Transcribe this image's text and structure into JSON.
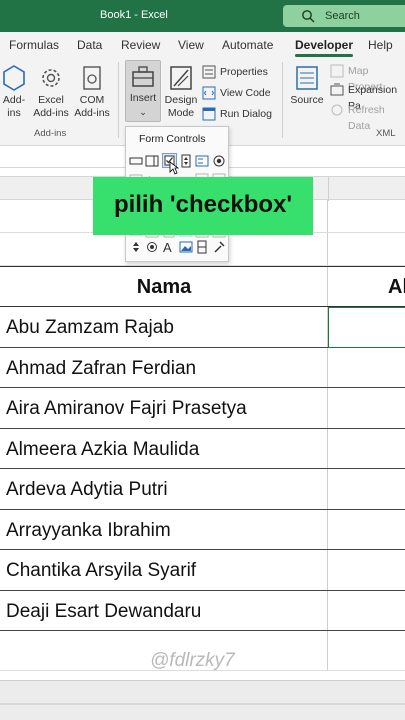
{
  "titlebar": {
    "title": "Book1  -  Excel",
    "search_label": "Search",
    "search_icon": "search-icon",
    "color": "#217346"
  },
  "tabs": [
    {
      "label": "Formulas"
    },
    {
      "label": "Data"
    },
    {
      "label": "Review"
    },
    {
      "label": "View"
    },
    {
      "label": "Automate"
    },
    {
      "label": "Developer",
      "active": true
    },
    {
      "label": "Help"
    }
  ],
  "ribbon": {
    "addins": {
      "add_ins": "Add-\nins",
      "excel_add_ins": "Excel\nAdd-ins",
      "com_add_ins": "COM\nAdd-ins",
      "group_label": "Add-ins"
    },
    "controls": {
      "insert": "Insert",
      "design_mode": "Design\nMode",
      "properties": "Properties",
      "view_code": "View Code",
      "run_dialog": "Run Dialog"
    },
    "xml": {
      "source": "Source",
      "map_properties": "Map Propert",
      "expansion_packs": "Expansion Pa",
      "refresh_data": "Refresh Data",
      "group_label": "XML"
    }
  },
  "dropdown": {
    "title": "Form Controls"
  },
  "caption": {
    "text": "pilih 'checkbox'",
    "color": "#37e06c"
  },
  "sheet": {
    "header_name": "Nama",
    "header_b": "Al",
    "names": [
      "Abu Zamzam Rajab",
      "Ahmad Zafran Ferdian",
      "Aira Amiranov Fajri Prasetya",
      "Almeera Azkia Maulida",
      "Ardeva Adytia Putri",
      "Arrayyanka Ibrahim",
      "Chantika Arsyila Syarif",
      "Deaji Esart Dewandaru"
    ]
  },
  "watermark": "@fdlrzky7"
}
